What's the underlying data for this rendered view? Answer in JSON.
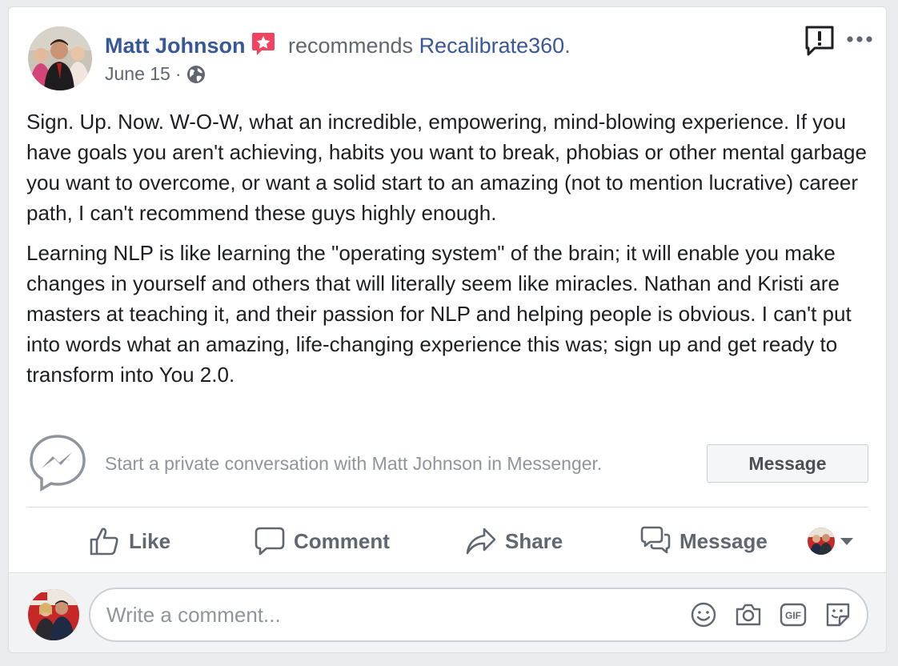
{
  "post": {
    "author": "Matt Johnson",
    "recommends_text": " recommends ",
    "page_name": "Recalibrate360",
    "page_suffix": ".",
    "date": "June 15",
    "separator": "·",
    "paragraphs": [
      "Sign. Up. Now. W-O-W, what an incredible, empowering, mind-blowing experience. If you have goals you aren't achieving, habits you want to break, phobias or other mental garbage you want to overcome, or want a solid start to an amazing (not to mention lucrative) career path, I can't recommend these guys highly enough.",
      "Learning NLP is like learning the \"operating system\" of the brain; it will enable you make changes in yourself and others that will literally seem like miracles. Nathan and Kristi are masters at teaching it, and their passion for NLP and helping people is obvious. I can't put into words what an amazing, life-changing experience this was; sign up and get ready to transform into You 2.0."
    ]
  },
  "messenger": {
    "prompt": "Start a private conversation with Matt Johnson in Messenger.",
    "button_label": "Message"
  },
  "actions": {
    "like": "Like",
    "comment": "Comment",
    "share": "Share",
    "message": "Message"
  },
  "comment": {
    "placeholder": "Write a comment..."
  },
  "icons": {
    "badge": "recommendation-star-icon",
    "audience": "globe-icon",
    "report": "report-flag-icon",
    "more": "more-options-icon"
  },
  "colors": {
    "link": "#365899",
    "muted": "#606770",
    "badge": "#f3425f"
  }
}
